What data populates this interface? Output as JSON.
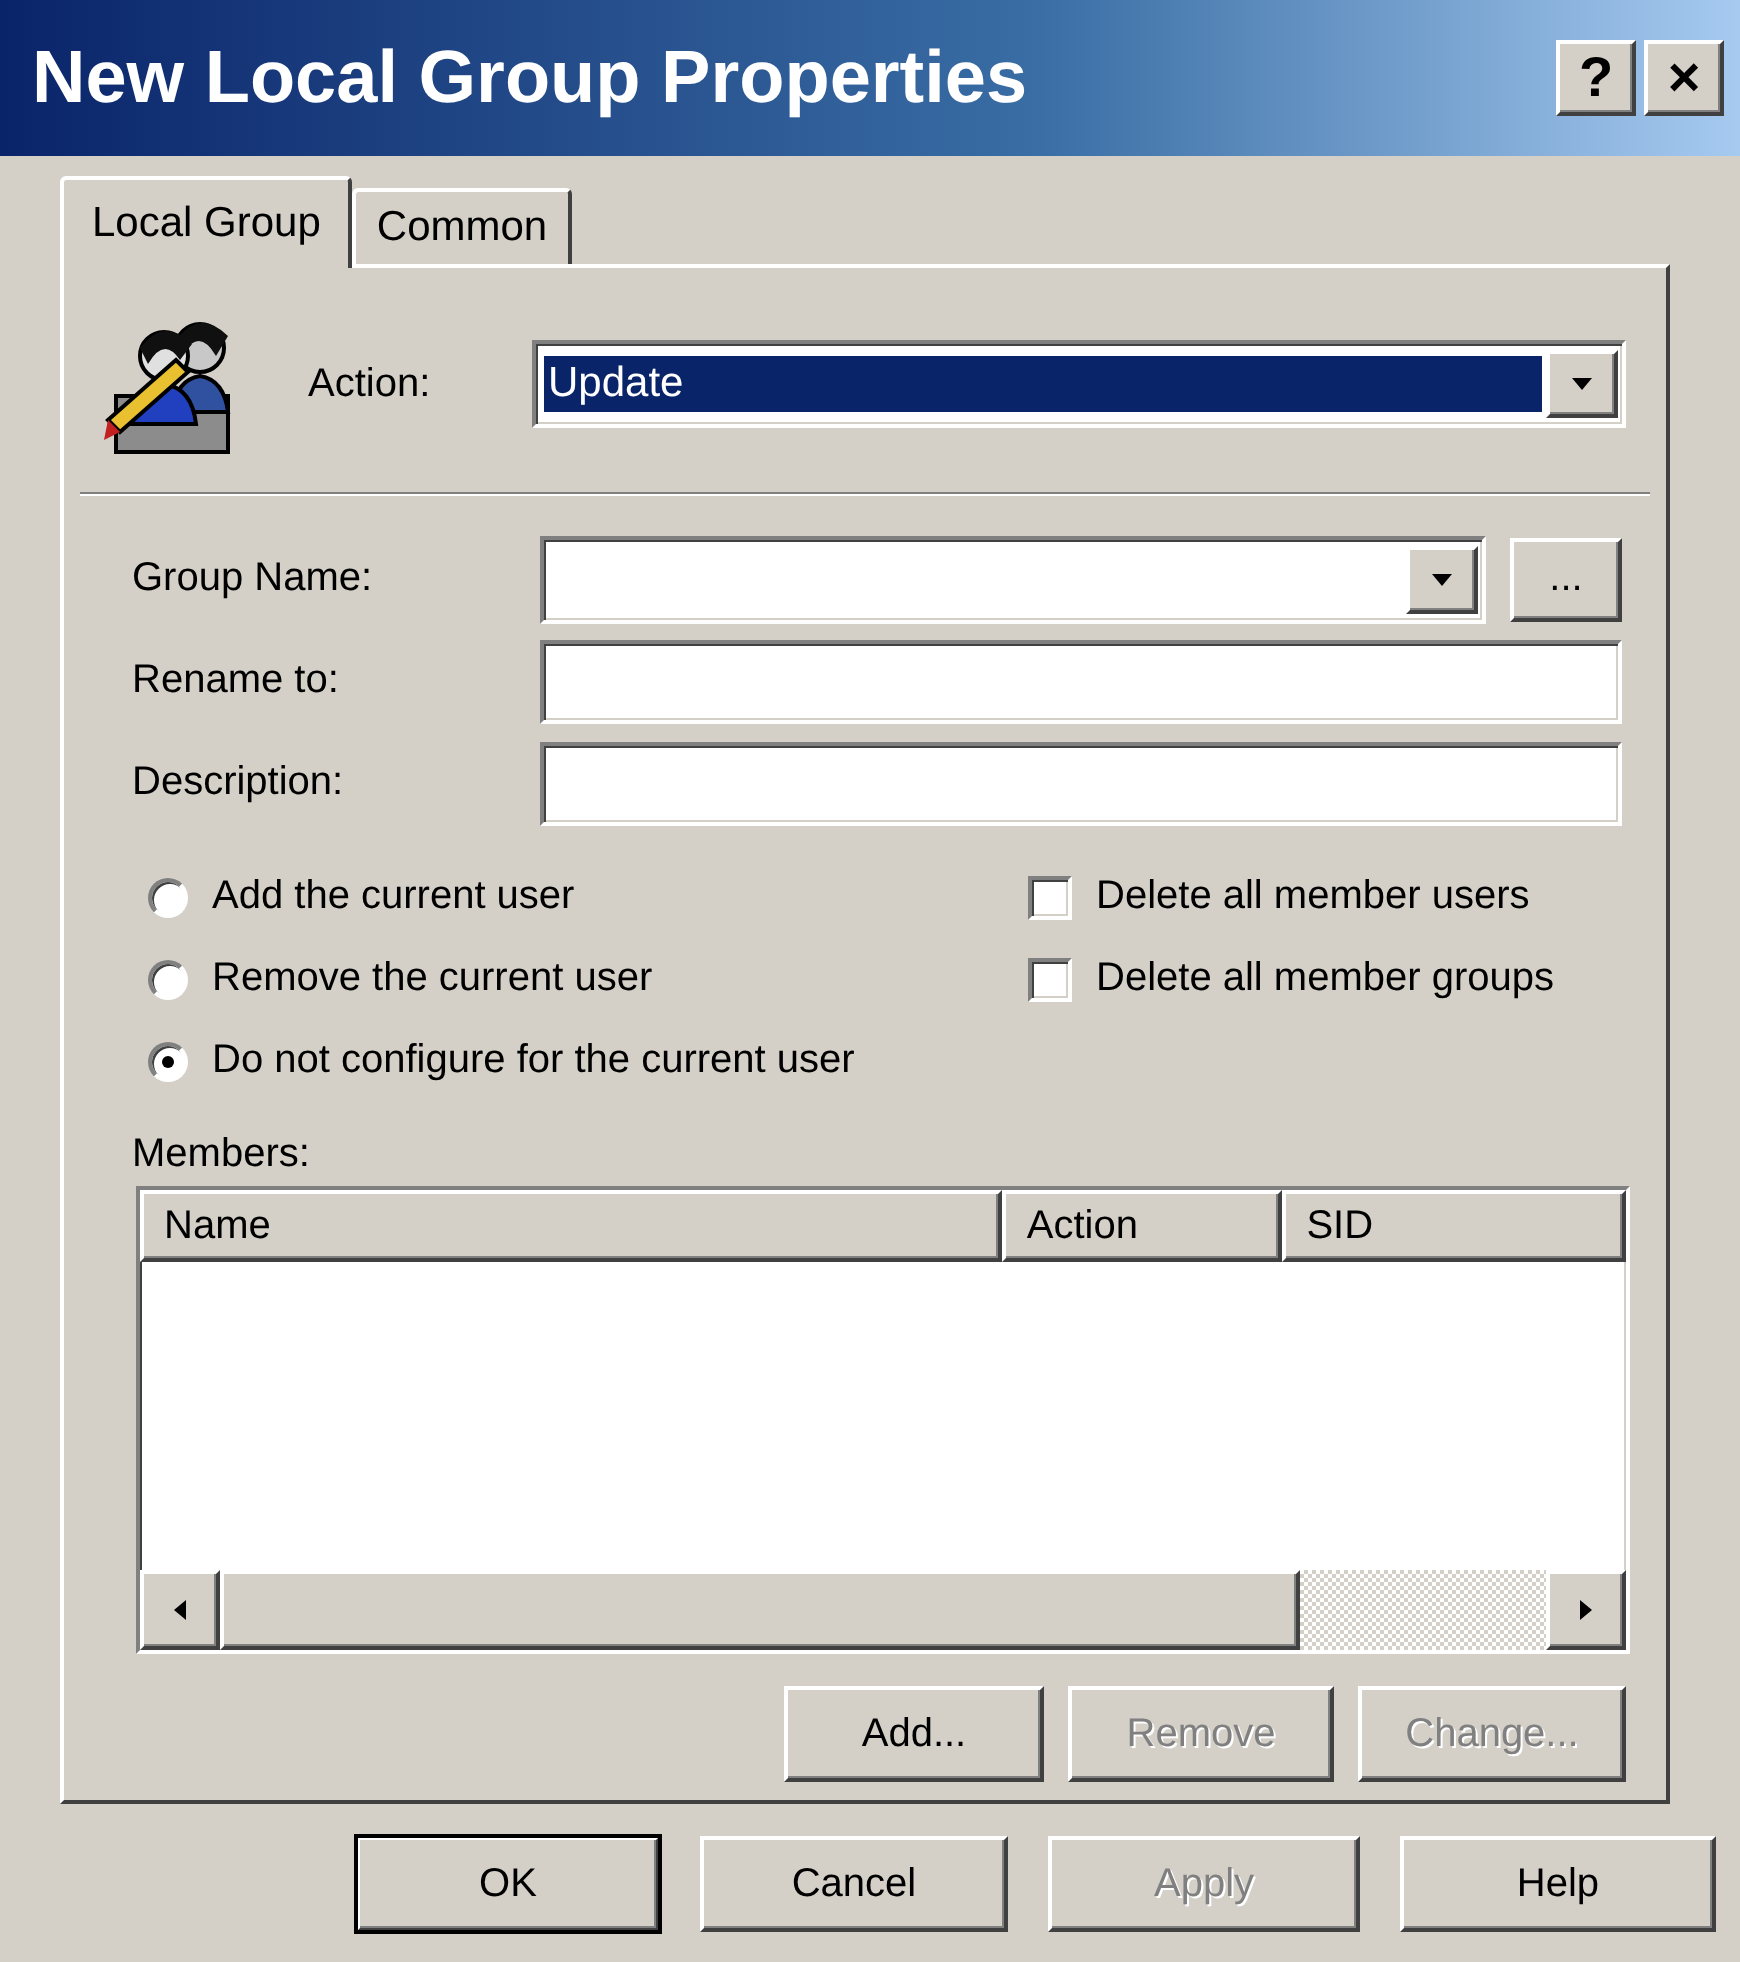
{
  "window": {
    "title": "New Local Group Properties",
    "help_button": "?",
    "close_button": "×"
  },
  "tabs": [
    {
      "label": "Local Group",
      "selected": true
    },
    {
      "label": "Common",
      "selected": false
    }
  ],
  "action": {
    "label": "Action:",
    "value": "Update",
    "highlighted": true
  },
  "fields": [
    {
      "kind": "combo",
      "label": "Group Name:",
      "browse": "..."
    },
    {
      "kind": "text",
      "label": "Rename to:"
    },
    {
      "kind": "text",
      "label": "Description:"
    }
  ],
  "radios": [
    {
      "label": "Add the current user",
      "selected": false
    },
    {
      "label": "Remove the current user",
      "selected": false
    },
    {
      "label": "Do not configure for the current user",
      "selected": true
    }
  ],
  "checkboxes": [
    {
      "label": "Delete all member users",
      "checked": false
    },
    {
      "label": "Delete all member groups",
      "checked": false
    }
  ],
  "members": {
    "label": "Members:",
    "columns": [
      "Name",
      "Action",
      "SID"
    ]
  },
  "member_buttons": [
    {
      "label": "Add...",
      "disabled": false
    },
    {
      "label": "Remove",
      "disabled": true
    },
    {
      "label": "Change...",
      "disabled": true
    }
  ],
  "dialog_buttons": [
    {
      "label": "OK",
      "disabled": false,
      "default": true
    },
    {
      "label": "Cancel",
      "disabled": false,
      "default": false
    },
    {
      "label": "Apply",
      "disabled": true,
      "default": false
    },
    {
      "label": "Help",
      "disabled": false,
      "default": false
    }
  ]
}
